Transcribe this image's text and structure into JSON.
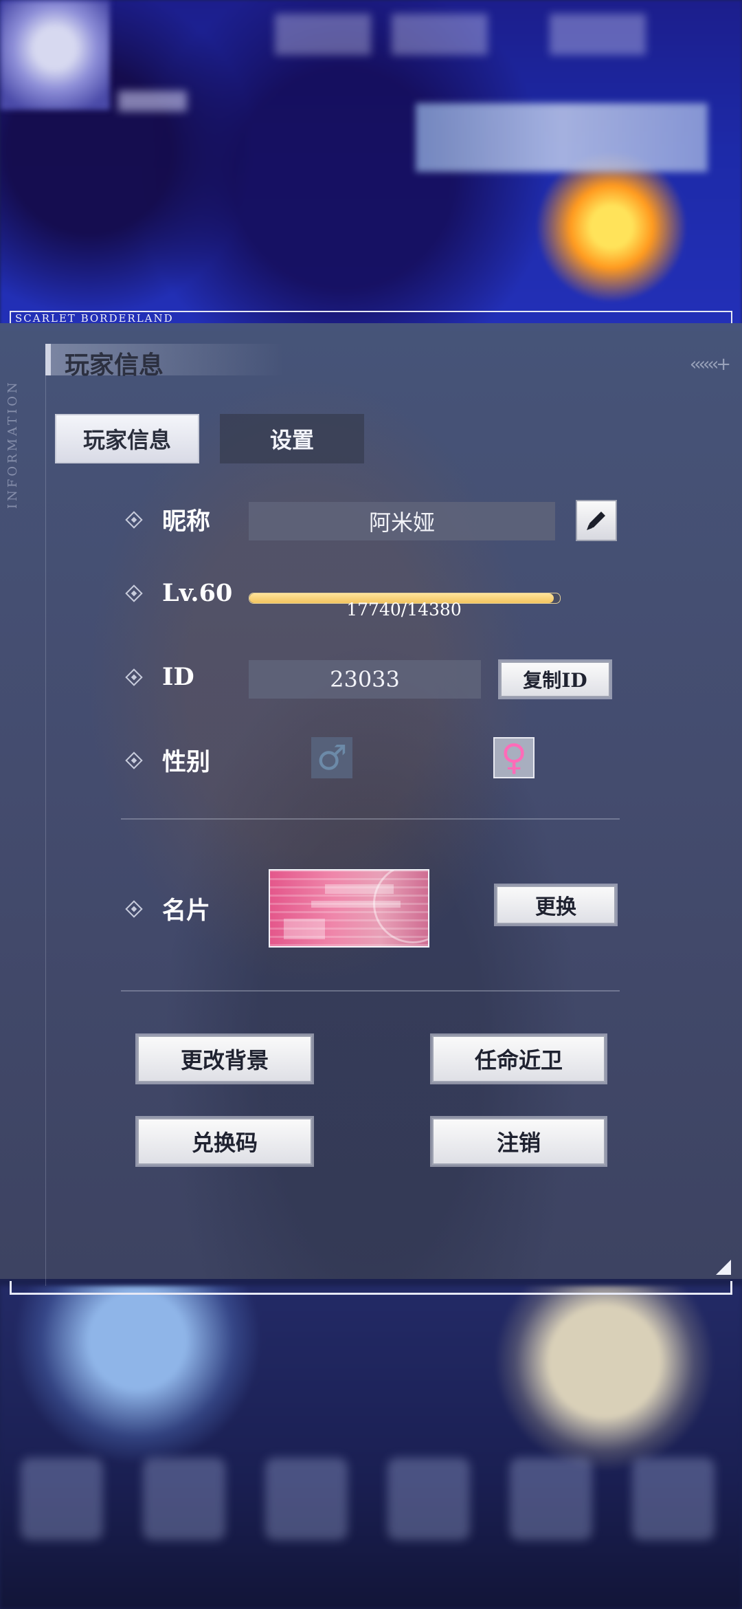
{
  "panel": {
    "frame_caption": "SCARLET BORDERLAND",
    "side_caption": "INFORMATION",
    "title": "玩家信息",
    "tabs": [
      {
        "label": "玩家信息",
        "active": true
      },
      {
        "label": "设置",
        "active": false
      }
    ]
  },
  "nickname": {
    "label": "昵称",
    "value": "阿米娅"
  },
  "level": {
    "label": "Lv.60",
    "exp_text": "17740/14380",
    "bar_fill_fraction": 0.98
  },
  "id": {
    "label": "ID",
    "value": "23033",
    "copy_button": "复制ID"
  },
  "gender": {
    "label": "性别",
    "male_symbol": "♂",
    "female_symbol": "♀"
  },
  "namecard": {
    "label": "名片",
    "change_button": "更换"
  },
  "actions": {
    "change_background": "更改背景",
    "appoint_guard": "任命近卫",
    "redeem_code": "兑换码",
    "logout": "注销"
  },
  "colors": {
    "panel_bg": "#4a567a",
    "xp_bar": "#f3c560",
    "male_icon": "#6c8aa8",
    "female_icon": "#ff6bb8",
    "namecard_pink": "#e4578b"
  }
}
